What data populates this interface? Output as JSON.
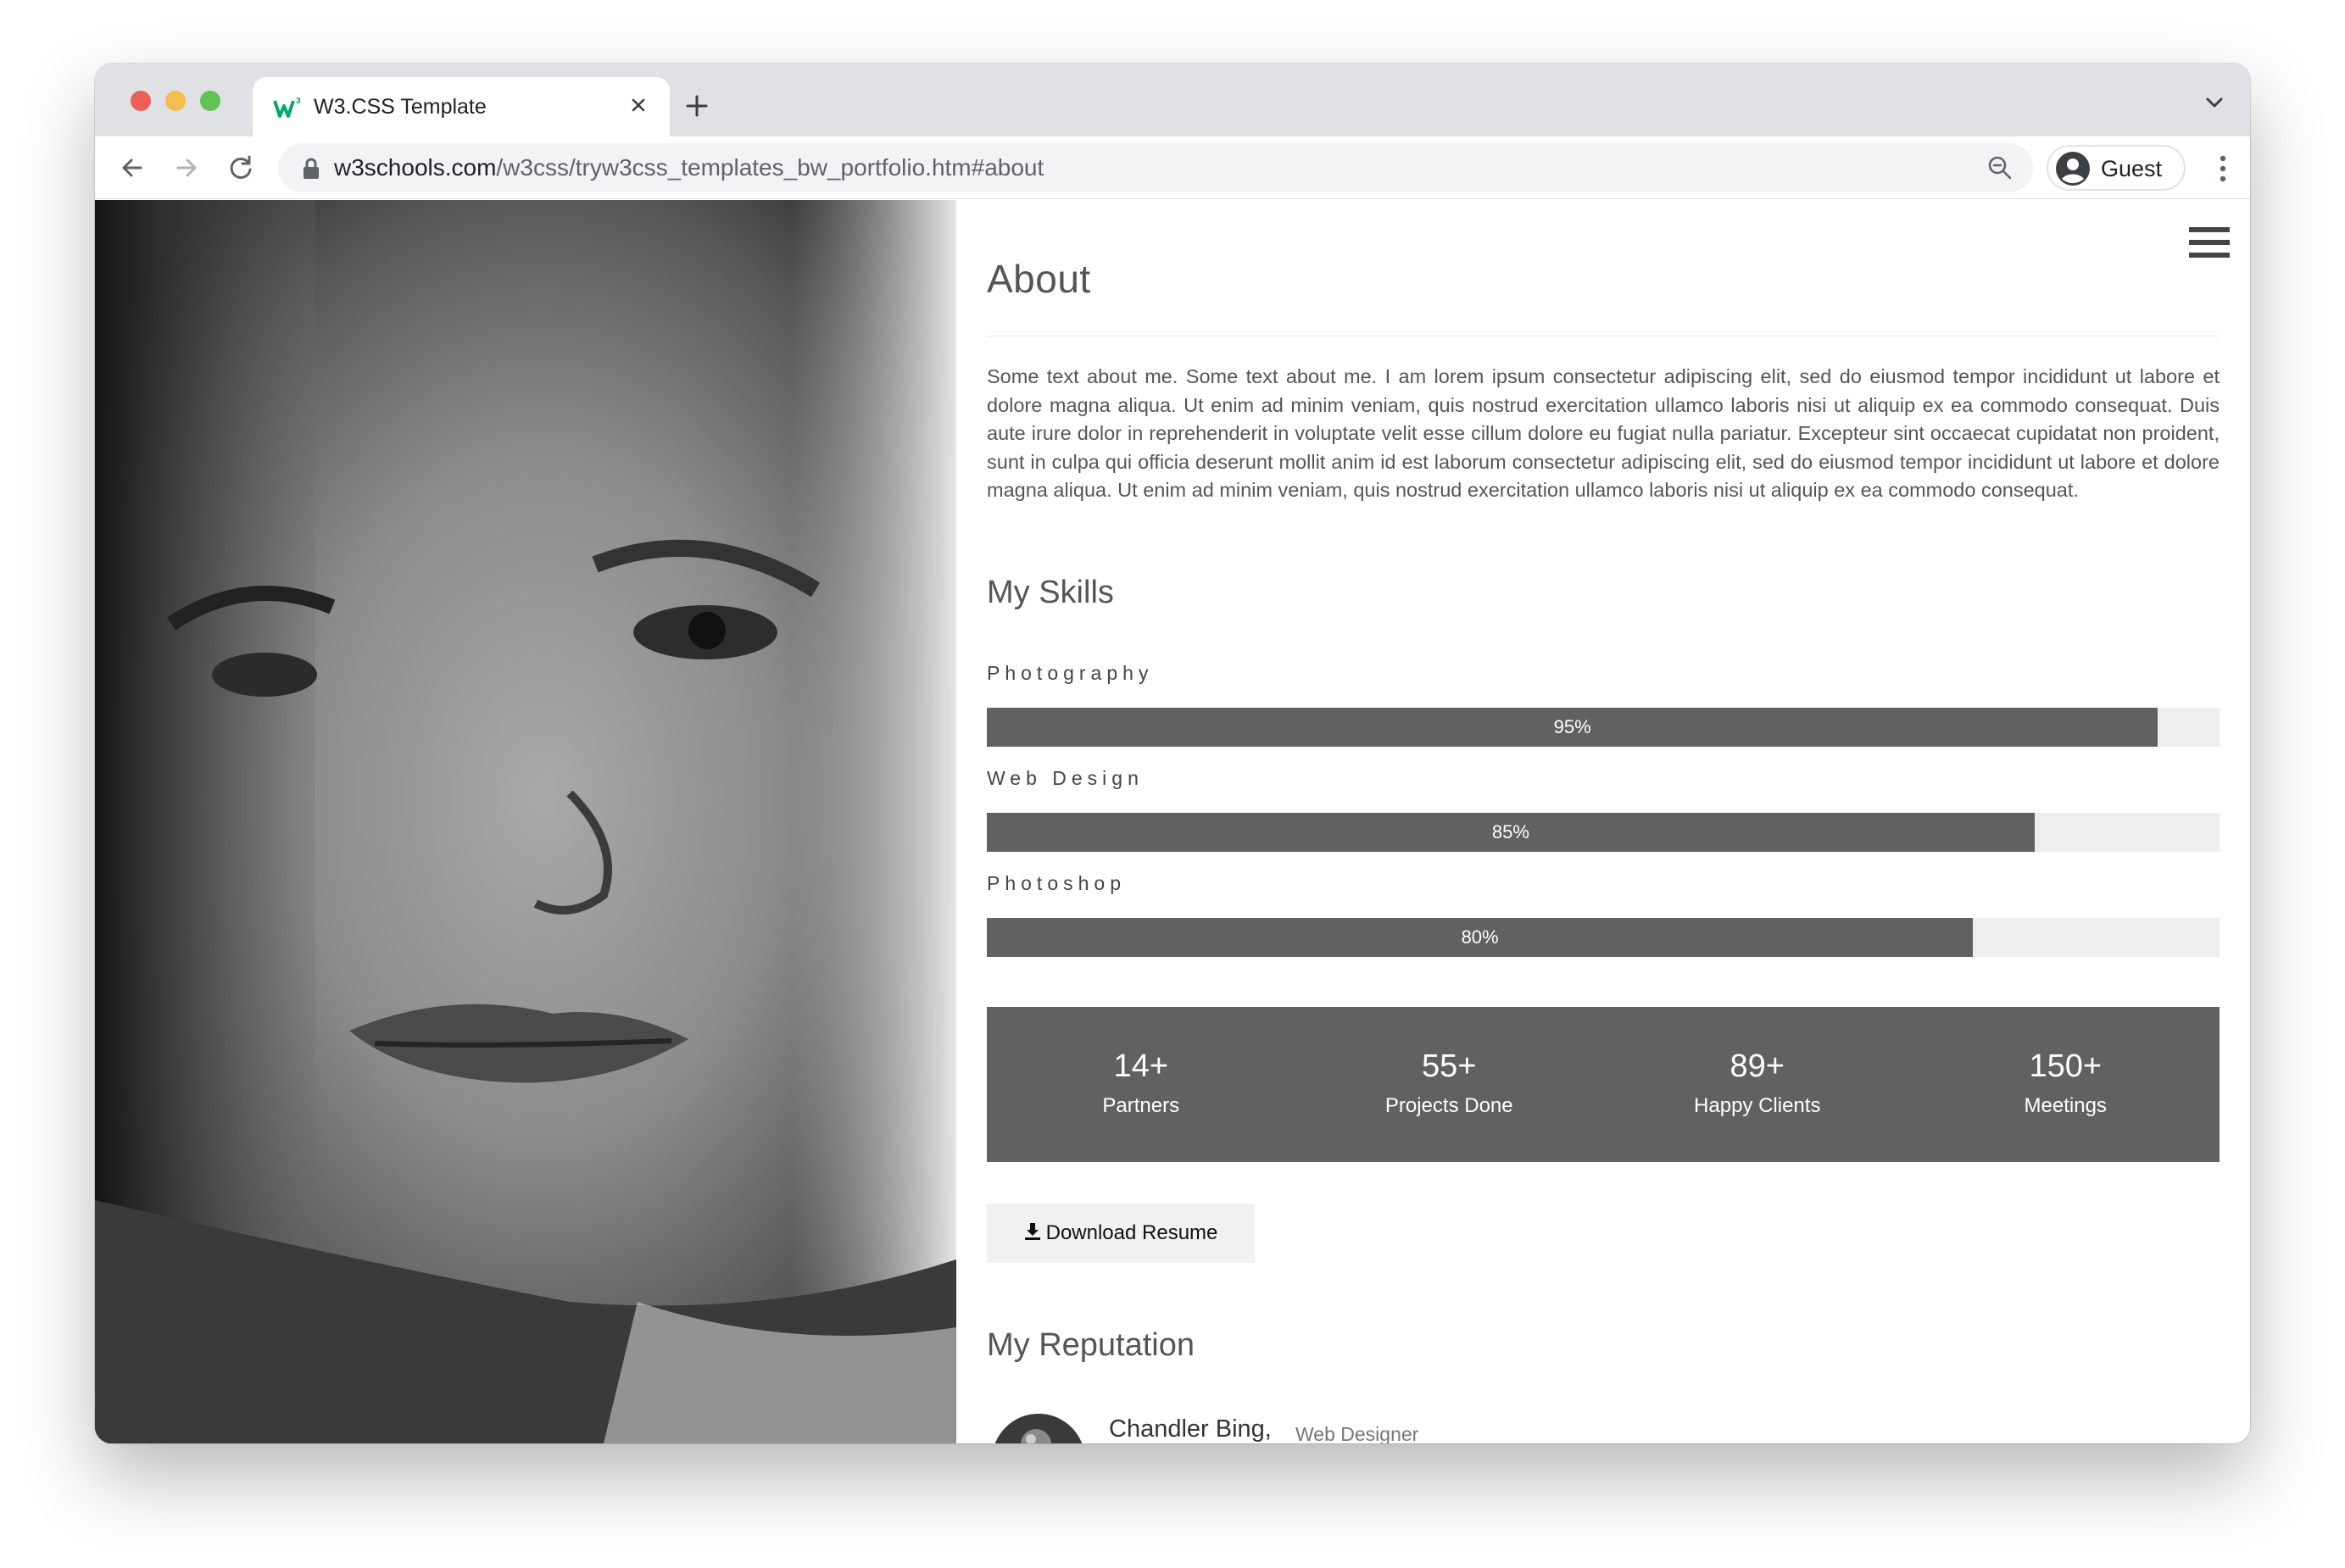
{
  "browser": {
    "tab_title": "W3.CSS Template",
    "url_host": "w3schools.com",
    "url_path": "/w3css/tryw3css_templates_bw_portfolio.htm#about",
    "profile_label": "Guest",
    "traffic_colors": {
      "close": "#ee5f57",
      "minimize": "#f4bd4f",
      "zoom": "#5fc454"
    }
  },
  "page": {
    "about_heading": "About",
    "about_text": "Some text about me. Some text about me. I am lorem ipsum consectetur adipiscing elit, sed do eiusmod tempor incididunt ut labore et dolore magna aliqua. Ut enim ad minim veniam, quis nostrud exercitation ullamco laboris nisi ut aliquip ex ea commodo consequat. Duis aute irure dolor in reprehenderit in voluptate velit esse cillum dolore eu fugiat nulla pariatur. Excepteur sint occaecat cupidatat non proident, sunt in culpa qui officia deserunt mollit anim id est laborum consectetur adipiscing elit, sed do eiusmod tempor incididunt ut labore et dolore magna aliqua. Ut enim ad minim veniam, quis nostrud exercitation ullamco laboris nisi ut aliquip ex ea commodo consequat.",
    "skills_heading": "My Skills",
    "skills": [
      {
        "label": "Photography",
        "percent_label": "95%",
        "value": 95
      },
      {
        "label": "Web Design",
        "percent_label": "85%",
        "value": 85
      },
      {
        "label": "Photoshop",
        "percent_label": "80%",
        "value": 80
      }
    ],
    "stats": [
      {
        "value": "14+",
        "label": "Partners"
      },
      {
        "value": "55+",
        "label": "Projects Done"
      },
      {
        "value": "89+",
        "label": "Happy Clients"
      },
      {
        "value": "150+",
        "label": "Meetings"
      }
    ],
    "download_label": "Download Resume",
    "reputation_heading": "My Reputation",
    "reputation": {
      "name": "Chandler Bing,",
      "role": "Web Designer"
    },
    "colors": {
      "bar_fill": "#616161",
      "bar_track": "#eeeeee",
      "text": "#555555"
    }
  },
  "icons": [
    "w3schools-favicon",
    "close-tab-icon",
    "new-tab-icon",
    "tab-search-icon",
    "back-arrow-icon",
    "forward-arrow-icon",
    "reload-icon",
    "lock-icon",
    "zoom-icon",
    "avatar-icon",
    "kebab-menu-icon",
    "hamburger-menu-icon",
    "download-icon"
  ]
}
